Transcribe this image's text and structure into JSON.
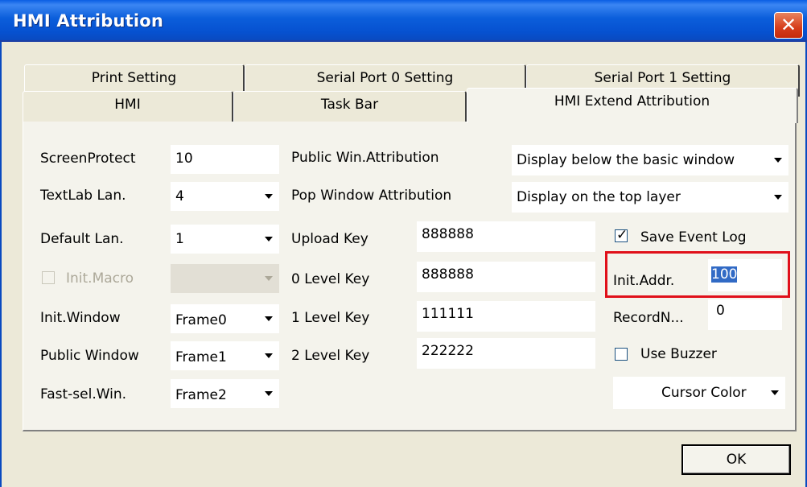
{
  "window": {
    "title": "HMI Attribution"
  },
  "tabs_back": [
    "Print Setting",
    "Serial Port 0 Setting",
    "Serial Port 1 Setting"
  ],
  "tabs_front": [
    "HMI",
    "Task Bar",
    "HMI Extend Attribution"
  ],
  "active_tab": "HMI Extend Attribution",
  "left": {
    "screen_protect": {
      "label": "ScreenProtect",
      "value": "10"
    },
    "textlab_lan": {
      "label": "TextLab Lan.",
      "value": "4"
    },
    "default_lan": {
      "label": "Default Lan.",
      "value": "1"
    },
    "init_macro": {
      "label": "Init.Macro",
      "value": ""
    },
    "init_window": {
      "label": "Init.Window",
      "value": "Frame0"
    },
    "public_window": {
      "label": "Public Window",
      "value": "Frame1"
    },
    "fast_sel_win": {
      "label": "Fast-sel.Win.",
      "value": "Frame2"
    }
  },
  "middle": {
    "public_win_attr": {
      "label": "Public Win.Attribution",
      "value": "Display below the basic window"
    },
    "pop_window_attr": {
      "label": "Pop Window Attribution",
      "value": "Display on the top layer"
    },
    "upload_key": {
      "label": "Upload Key",
      "value": "888888"
    },
    "level0_key": {
      "label": "0 Level Key",
      "value": "888888"
    },
    "level1_key": {
      "label": "1 Level Key",
      "value": "111111"
    },
    "level2_key": {
      "label": "2 Level Key",
      "value": "222222"
    }
  },
  "right": {
    "save_event_log": {
      "label": "Save Event Log",
      "checked": true
    },
    "init_addr": {
      "label": "Init.Addr.",
      "value": "100"
    },
    "record_n": {
      "label": "RecordN...",
      "value": "0"
    },
    "use_buzzer": {
      "label": "Use Buzzer",
      "checked": false
    },
    "cursor_color": {
      "label": "Cursor Color"
    }
  },
  "ok_label": "OK",
  "colors": {
    "title_bar": "#0a5ee4",
    "highlight": "#e0101a",
    "selection": "#316ac5"
  }
}
